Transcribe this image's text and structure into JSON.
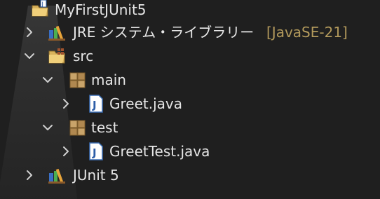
{
  "tree": {
    "project": {
      "label": "MyFirstJUnit5",
      "icon": "project-folder-icon"
    },
    "jre": {
      "label": "JRE システム・ライブラリー",
      "decoration": "[JavaSE-21]",
      "icon": "library-icon"
    },
    "src": {
      "label": "src",
      "icon": "source-folder-icon"
    },
    "main": {
      "label": "main",
      "icon": "package-icon"
    },
    "greet": {
      "label": "Greet.java",
      "icon": "java-file-icon"
    },
    "test": {
      "label": "test",
      "icon": "package-icon"
    },
    "greettest": {
      "label": "GreetTest.java",
      "icon": "java-file-icon"
    },
    "junit": {
      "label": "JUnit 5",
      "icon": "library-icon"
    }
  },
  "colors": {
    "background": "#1f1f1f",
    "text": "#e6e6e6",
    "decoration": "#b39a5c"
  }
}
